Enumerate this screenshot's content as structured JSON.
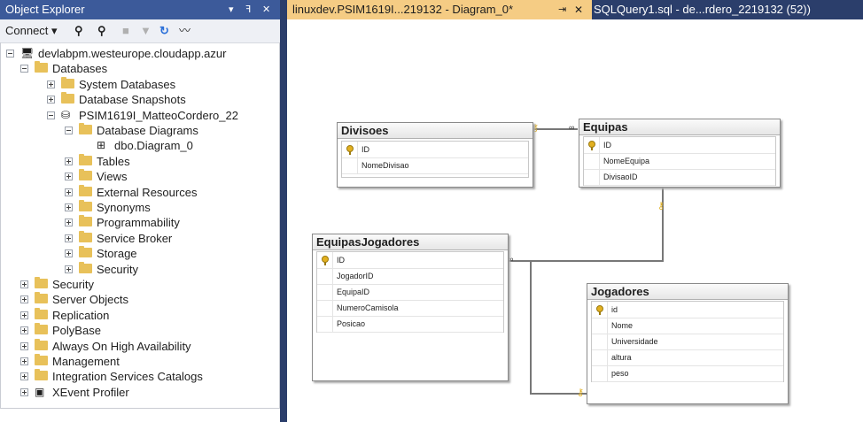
{
  "object_explorer": {
    "title": "Object Explorer",
    "controls": {
      "dropdown": "▾",
      "pin": "ꟻ",
      "close": "✕"
    },
    "toolbar": {
      "connect": "Connect ▾"
    },
    "tree": [
      {
        "label": "devlabpm.westeurope.cloudapp.azur",
        "icon": "server-icon",
        "expanded": true
      },
      {
        "label": "Databases",
        "icon": "folder-icon",
        "expanded": true
      },
      {
        "label": "System Databases",
        "icon": "folder-icon",
        "expanded": false
      },
      {
        "label": "Database Snapshots",
        "icon": "folder-icon",
        "expanded": false
      },
      {
        "label": "PSIM1619I_MatteoCordero_22",
        "icon": "database-icon",
        "expanded": true
      },
      {
        "label": "Database Diagrams",
        "icon": "folder-icon",
        "expanded": true
      },
      {
        "label": "dbo.Diagram_0",
        "icon": "diagram-icon"
      },
      {
        "label": "Tables",
        "icon": "folder-icon",
        "expanded": false
      },
      {
        "label": "Views",
        "icon": "folder-icon",
        "expanded": false
      },
      {
        "label": "External Resources",
        "icon": "folder-icon",
        "expanded": false
      },
      {
        "label": "Synonyms",
        "icon": "folder-icon",
        "expanded": false
      },
      {
        "label": "Programmability",
        "icon": "folder-icon",
        "expanded": false
      },
      {
        "label": "Service Broker",
        "icon": "folder-icon",
        "expanded": false
      },
      {
        "label": "Storage",
        "icon": "folder-icon",
        "expanded": false
      },
      {
        "label": "Security",
        "icon": "folder-icon",
        "expanded": false
      },
      {
        "label": "Security",
        "icon": "folder-icon",
        "expanded": false
      },
      {
        "label": "Server Objects",
        "icon": "folder-icon",
        "expanded": false
      },
      {
        "label": "Replication",
        "icon": "folder-icon",
        "expanded": false
      },
      {
        "label": "PolyBase",
        "icon": "folder-icon",
        "expanded": false
      },
      {
        "label": "Always On High Availability",
        "icon": "folder-icon",
        "expanded": false
      },
      {
        "label": "Management",
        "icon": "folder-icon",
        "expanded": false
      },
      {
        "label": "Integration Services Catalogs",
        "icon": "folder-icon",
        "expanded": false
      },
      {
        "label": "XEvent Profiler",
        "icon": "xevent-icon",
        "expanded": false
      }
    ]
  },
  "tabs": [
    {
      "label": "linuxdev.PSIM1619I...219132 - Diagram_0*",
      "pin": "⇥",
      "close": "✕",
      "active": true
    },
    {
      "label": "SQLQuery1.sql - de...rdero_2219132 (52))",
      "active": false
    }
  ],
  "diagram": {
    "tables": [
      {
        "name": "Divisoes",
        "columns": [
          {
            "name": "ID",
            "pk": true
          },
          {
            "name": "NomeDivisao",
            "pk": false
          }
        ]
      },
      {
        "name": "Equipas",
        "columns": [
          {
            "name": "ID",
            "pk": true
          },
          {
            "name": "NomeEquipa",
            "pk": false
          },
          {
            "name": "DivisaoID",
            "pk": false
          }
        ]
      },
      {
        "name": "EquipasJogadores",
        "columns": [
          {
            "name": "ID",
            "pk": true
          },
          {
            "name": "JogadorID",
            "pk": false
          },
          {
            "name": "EquipaID",
            "pk": false
          },
          {
            "name": "NumeroCamisola",
            "pk": false
          },
          {
            "name": "Posicao",
            "pk": false
          }
        ]
      },
      {
        "name": "Jogadores",
        "columns": [
          {
            "name": "id",
            "pk": true
          },
          {
            "name": "Nome",
            "pk": false
          },
          {
            "name": "Universidade",
            "pk": false
          },
          {
            "name": "altura",
            "pk": false
          },
          {
            "name": "peso",
            "pk": false
          }
        ]
      }
    ]
  },
  "colors": {
    "title_bar": "#3c5a9a",
    "dark_chrome": "#2b3e6b",
    "active_tab": "#f5cc84",
    "folder": "#e8c15a"
  }
}
